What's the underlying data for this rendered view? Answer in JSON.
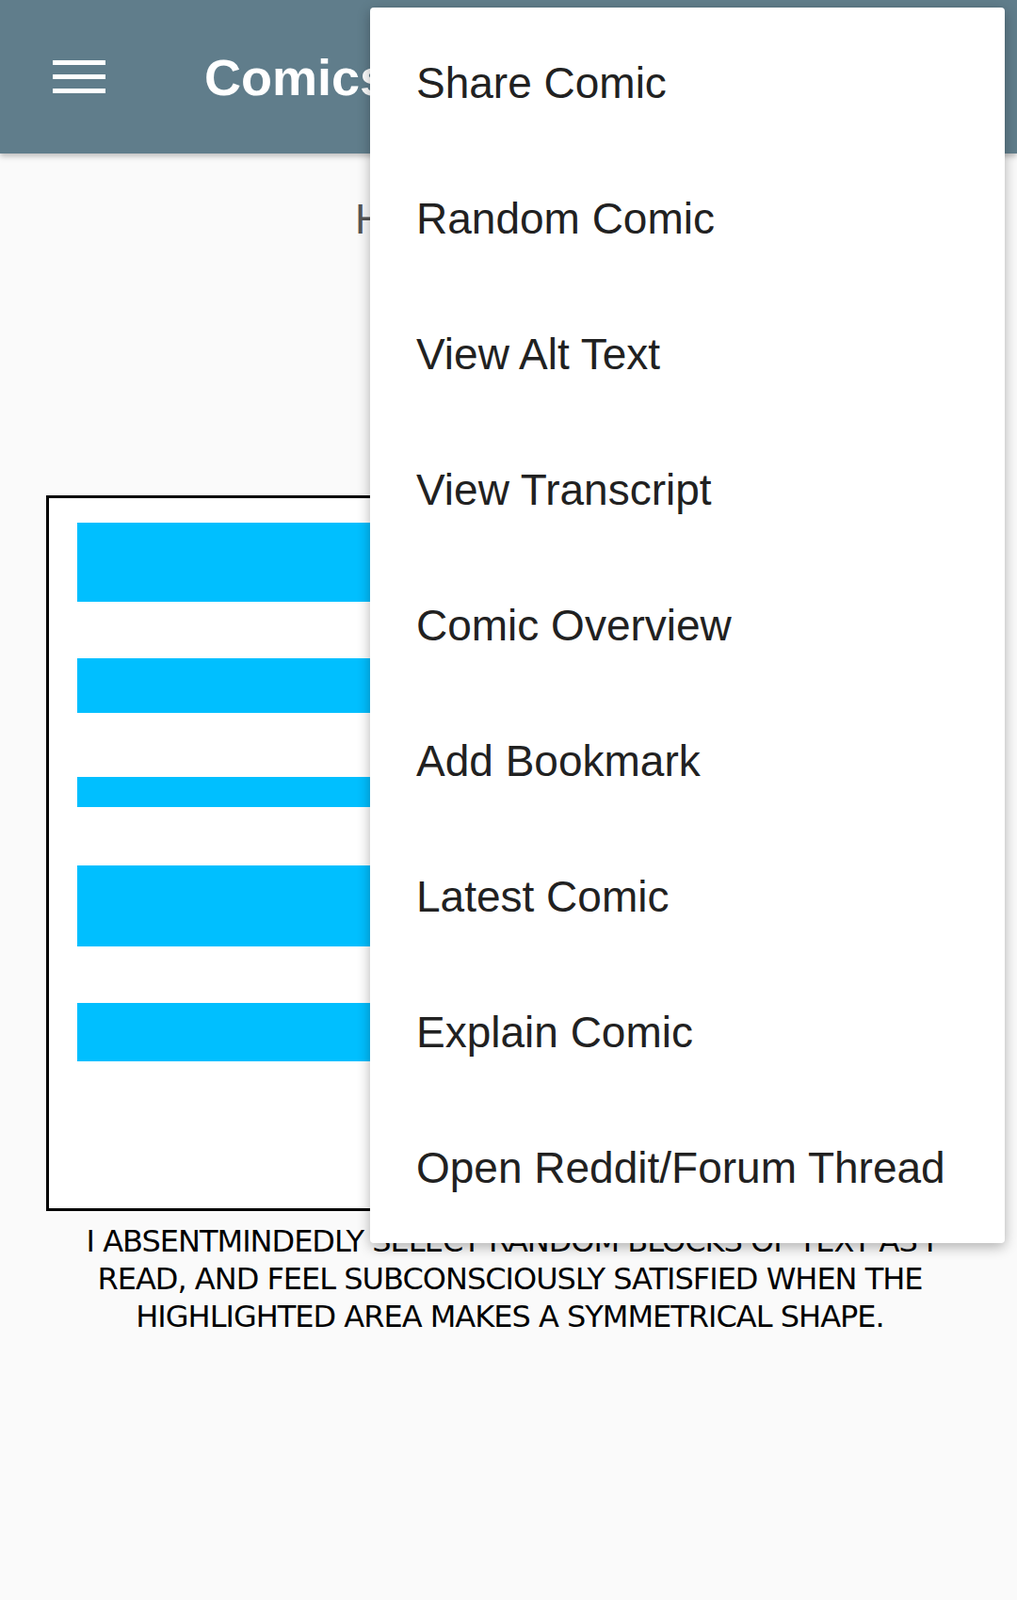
{
  "app_bar": {
    "title": "Comics"
  },
  "comic": {
    "title": "H",
    "caption": "I ABSENTMINDEDLY SELECT RANDOM BLOCKS OF TEXT AS I READ, AND FEEL SUBCONSCIOUSLY SATISFIED WHEN THE HIGHLIGHTED AREA MAKES A SYMMETRICAL SHAPE."
  },
  "menu": {
    "items": [
      {
        "label": "Share Comic"
      },
      {
        "label": "Random Comic"
      },
      {
        "label": "View Alt Text"
      },
      {
        "label": "View Transcript"
      },
      {
        "label": "Comic Overview"
      },
      {
        "label": "Add Bookmark"
      },
      {
        "label": "Latest Comic"
      },
      {
        "label": "Explain Comic"
      },
      {
        "label": "Open Reddit/Forum Thread"
      }
    ]
  }
}
